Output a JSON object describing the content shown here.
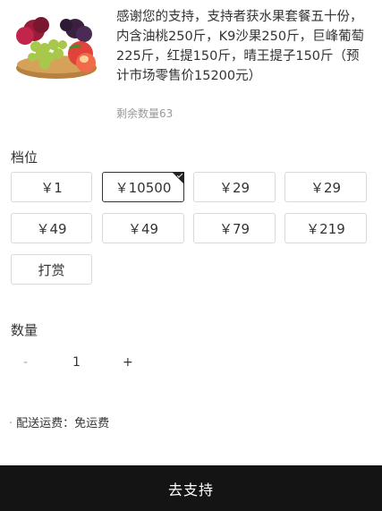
{
  "product": {
    "image_icon": "fruit-basket-image",
    "description": "感谢您的支持，支持者获水果套餐五十份，内含油桃250斤，K9沙果250斤，巨峰葡萄225斤，红提150斤，晴王提子150斤（预计市场零售价15200元）",
    "remaining": "剩余数量63"
  },
  "tiers": {
    "title": "档位",
    "selected_index": 1,
    "options": [
      "￥1",
      "￥10500",
      "￥29",
      "￥29",
      "￥49",
      "￥49",
      "￥79",
      "￥219",
      "打赏"
    ]
  },
  "quantity": {
    "title": "数量",
    "minus_label": "-",
    "value": "1",
    "plus_label": "+"
  },
  "shipping": {
    "bullet": "·",
    "text": "配送运费：免运费"
  },
  "submit": {
    "label": "去支持"
  },
  "colors": {
    "bottom_bar": "#141414",
    "border": "#d9d9d9",
    "selected_border": "#333333"
  }
}
